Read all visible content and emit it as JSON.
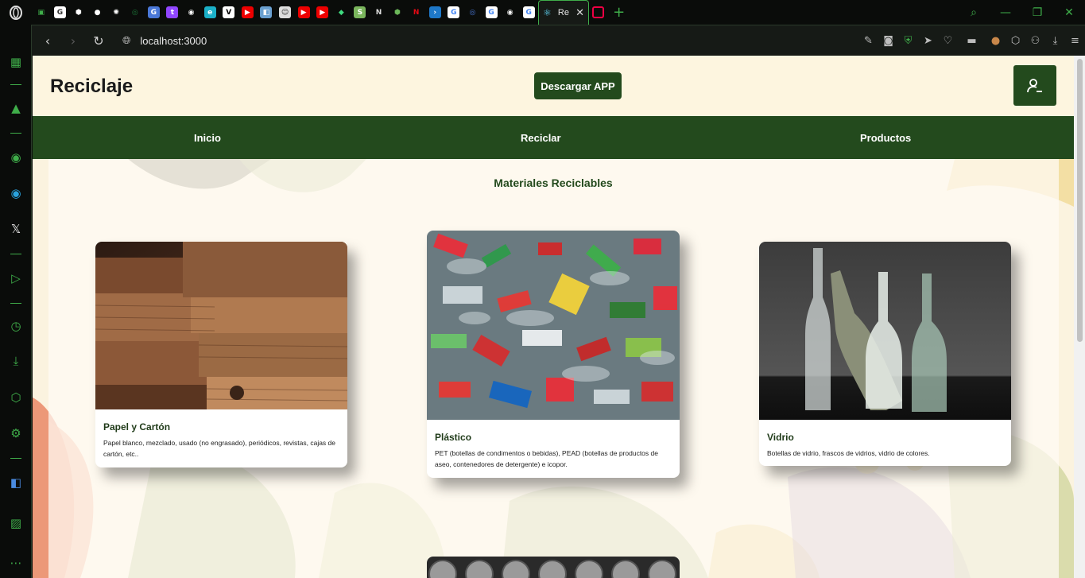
{
  "browser": {
    "active_tab_label": "Re",
    "address": "localhost:3000"
  },
  "page": {
    "brand": "Reciclaje",
    "download_button": "Descargar APP",
    "nav": [
      "Inicio",
      "Reciclar",
      "Productos"
    ],
    "section_title": "Materiales Reciclables",
    "cards": [
      {
        "title": "Papel y Cartón",
        "description": "Papel blanco, mezclado, usado (no engrasado), periódicos, revistas, cajas de cartón, etc.."
      },
      {
        "title": "Plástico",
        "description": "PET (botellas de condimentos o bebidas), PEAD (botellas de productos de aseo, contenedores de detergente) e icopor."
      },
      {
        "title": "Vidrio",
        "description": "Botellas de vidrio, frascos de vidrios, vidrio de colores."
      }
    ]
  },
  "colors": {
    "primary": "#234a1d",
    "page_bg": "#fdf5df",
    "browser_accent": "#3fae4a"
  }
}
